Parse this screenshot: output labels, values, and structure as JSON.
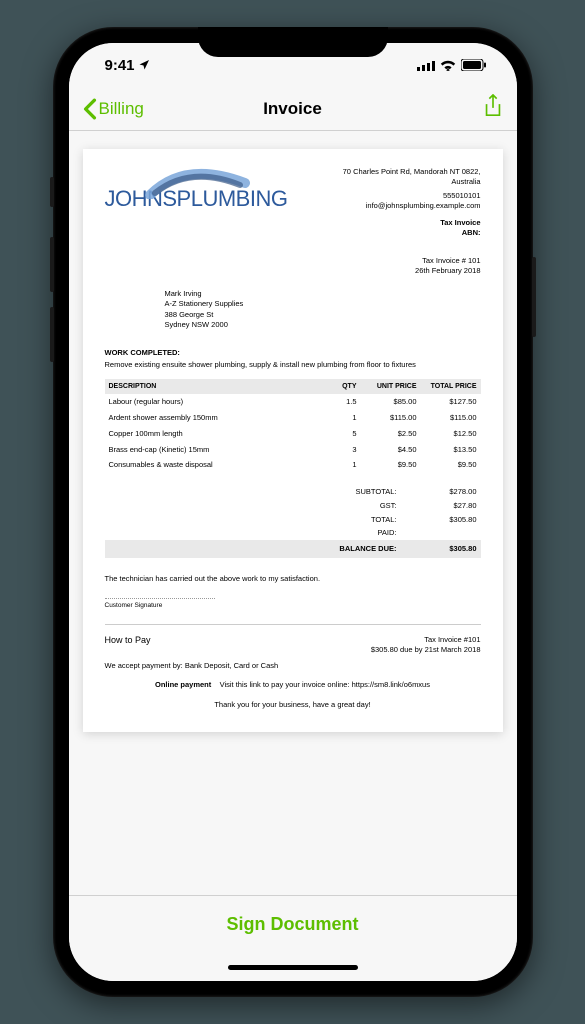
{
  "status": {
    "time": "9:41"
  },
  "nav": {
    "back_label": "Billing",
    "title": "Invoice"
  },
  "company": {
    "logo_text": "JOHNSPLUMBING",
    "address_line1": "70 Charles Point Rd, Mandorah NT 0822,",
    "address_line2": "Australia",
    "phone": "555010101",
    "email": "info@johnsplumbing.example.com",
    "tax_invoice_label": "Tax Invoice",
    "abn_label": "ABN:"
  },
  "invoice_meta": {
    "number": "Tax Invoice # 101",
    "date": "26th February 2018"
  },
  "customer": {
    "name": "Mark Irving",
    "company": "A-Z Stationery Supplies",
    "street": "388 George St",
    "city": "Sydney NSW 2000"
  },
  "work": {
    "title": "WORK COMPLETED:",
    "description": "Remove existing ensuite shower plumbing, supply & install new plumbing from floor to fixtures"
  },
  "table": {
    "headers": {
      "description": "DESCRIPTION",
      "qty": "QTY",
      "unit_price": "UNIT PRICE",
      "total_price": "TOTAL PRICE"
    },
    "rows": [
      {
        "desc": "Labour (regular hours)",
        "qty": "1.5",
        "unit": "$85.00",
        "total": "$127.50"
      },
      {
        "desc": "Ardent shower assembly 150mm",
        "qty": "1",
        "unit": "$115.00",
        "total": "$115.00"
      },
      {
        "desc": "Copper 100mm length",
        "qty": "5",
        "unit": "$2.50",
        "total": "$12.50"
      },
      {
        "desc": "Brass end-cap (Kinetic) 15mm",
        "qty": "3",
        "unit": "$4.50",
        "total": "$13.50"
      },
      {
        "desc": "Consumables & waste disposal",
        "qty": "1",
        "unit": "$9.50",
        "total": "$9.50"
      }
    ]
  },
  "totals": {
    "subtotal_label": "SUBTOTAL:",
    "subtotal": "$278.00",
    "gst_label": "GST:",
    "gst": "$27.80",
    "total_label": "TOTAL:",
    "total": "$305.80",
    "paid_label": "PAID:",
    "paid": "",
    "balance_label": "BALANCE DUE:",
    "balance": "$305.80"
  },
  "signature": {
    "satisfaction": "The technician has carried out the above work to my satisfaction.",
    "label": "Customer Signature"
  },
  "payment": {
    "title": "How to Pay",
    "invoice_ref": "Tax Invoice #101",
    "due": "$305.80 due by 21st March 2018",
    "methods": "We accept payment by: Bank Deposit, Card or Cash",
    "online_label": "Online payment",
    "online_text": "Visit this link to pay your invoice online: https://sm8.link/o6mxus",
    "thank_you": "Thank you for your business, have a great day!"
  },
  "footer": {
    "sign_button": "Sign Document"
  }
}
